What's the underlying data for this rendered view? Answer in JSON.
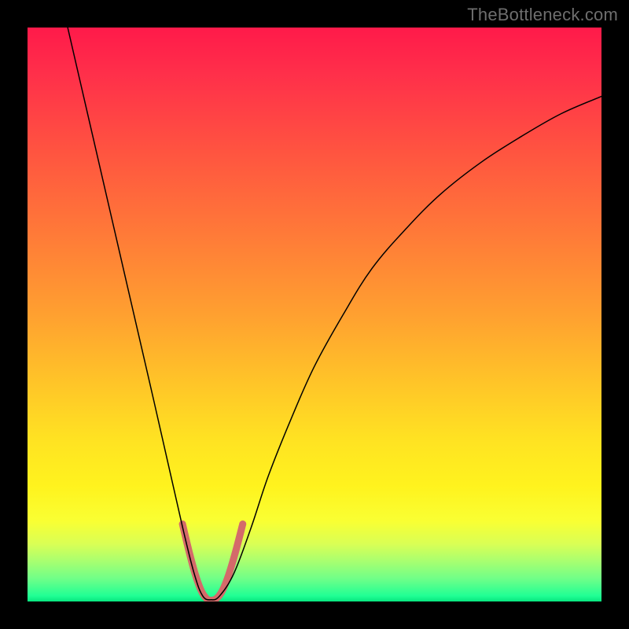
{
  "watermark": "TheBottleneck.com",
  "chart_data": {
    "type": "line",
    "title": "",
    "xlabel": "",
    "ylabel": "",
    "xlim": [
      0,
      100
    ],
    "ylim": [
      0,
      100
    ],
    "grid": false,
    "legend": false,
    "series": [
      {
        "name": "main-curve",
        "color": "#000000",
        "width": 1.5,
        "x": [
          7,
          10,
          13,
          16,
          19,
          22,
          24.5,
          27,
          29,
          30.5,
          32,
          33.5,
          36,
          39,
          42,
          46,
          50,
          55,
          60,
          66,
          72,
          79,
          86,
          93,
          100
        ],
        "y": [
          100,
          87,
          74,
          61,
          48,
          35,
          24,
          13,
          5,
          1,
          0.3,
          1,
          5,
          13,
          22,
          32,
          41,
          50,
          58,
          65,
          71,
          76.5,
          81,
          85,
          88
        ]
      },
      {
        "name": "bottom-highlight",
        "color": "#d46a6a",
        "width": 9,
        "x": [
          27,
          28.2,
          29.3,
          30.3,
          31.2,
          32,
          32.9,
          33.9,
          35,
          36.2,
          37.5
        ],
        "y": [
          13.5,
          8.5,
          4.5,
          1.8,
          0.5,
          0.2,
          0.5,
          1.8,
          4.5,
          8.5,
          13.5
        ]
      }
    ],
    "annotations": [
      {
        "text": "TheBottleneck.com",
        "position": "top-right"
      }
    ]
  }
}
